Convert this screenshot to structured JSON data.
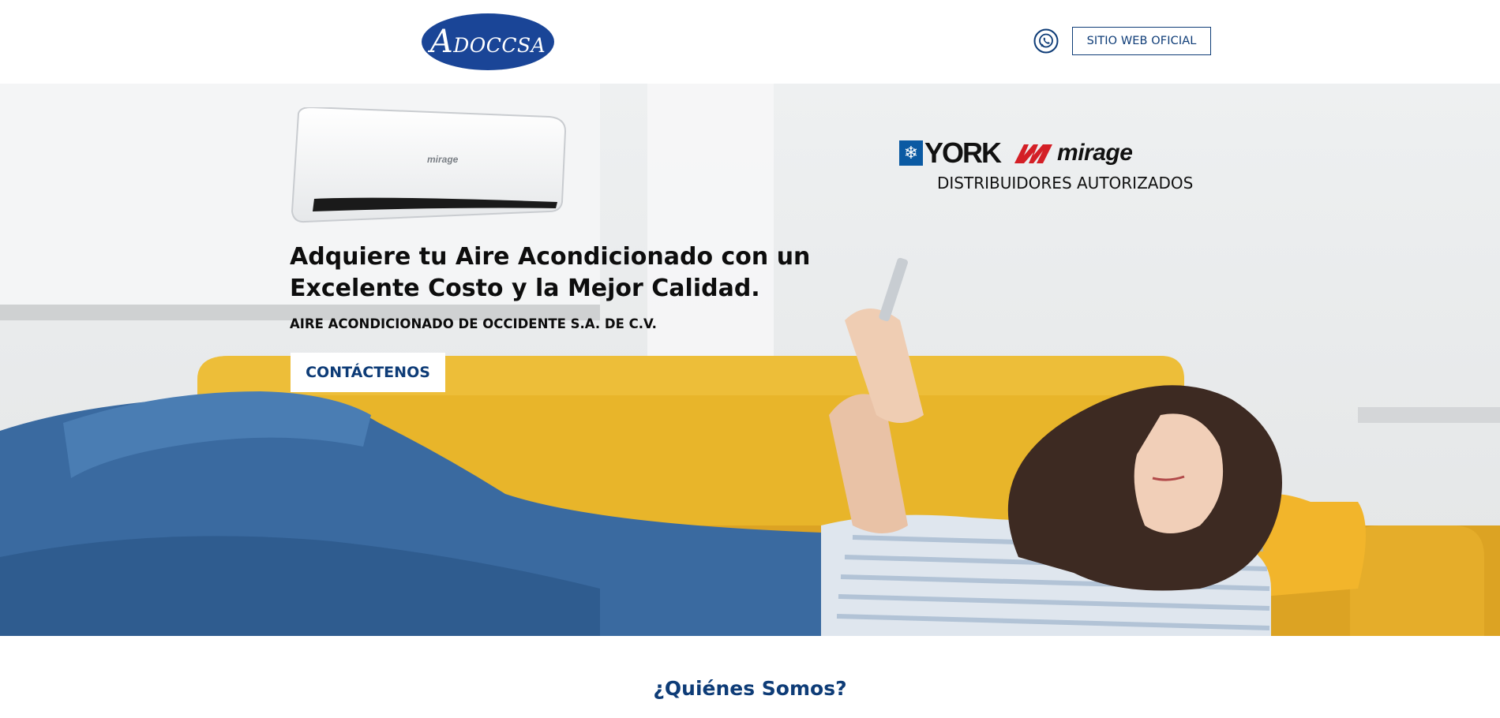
{
  "header": {
    "logo_text": "ADOCCSA",
    "logo_color": "#1a4597",
    "whatsapp_icon": "whatsapp-icon",
    "official_site_label": "SITIO WEB OFICIAL"
  },
  "hero": {
    "ac_unit_brand": "mirage",
    "brand_york": "YORK",
    "brand_mirage": "mirage",
    "brands_caption": "DISTRIBUIDORES AUTORIZADOS",
    "headline": "Adquiere tu Aire Acondicionado con un Excelente Costo y la Mejor Calidad.",
    "company_name": "AIRE ACONDICIONADO DE OCCIDENTE S.A. DE C.V.",
    "cta_label": "CONTÁCTENOS"
  },
  "section": {
    "title": "¿Quiénes Somos?"
  },
  "colors": {
    "brand_blue": "#0e3c77",
    "sofa_yellow": "#e8b52a"
  }
}
